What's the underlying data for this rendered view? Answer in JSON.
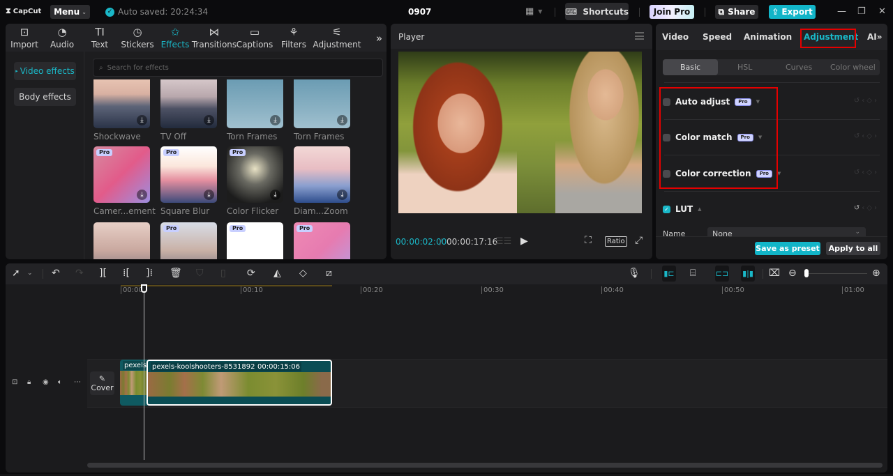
{
  "titlebar": {
    "app_name": "CapCut",
    "menu_label": "Menu",
    "autosave_text": "Auto saved: 20:24:34",
    "project_title": "0907",
    "shortcuts_label": "Shortcuts",
    "join_pro_label": "Join Pro",
    "share_label": "Share",
    "export_label": "Export"
  },
  "media_tabs": [
    {
      "label": "Import",
      "icon": "import-icon"
    },
    {
      "label": "Audio",
      "icon": "audio-icon"
    },
    {
      "label": "Text",
      "icon": "text-icon"
    },
    {
      "label": "Stickers",
      "icon": "stickers-icon"
    },
    {
      "label": "Effects",
      "icon": "effects-icon",
      "active": true
    },
    {
      "label": "Transitions",
      "icon": "transitions-icon"
    },
    {
      "label": "Captions",
      "icon": "captions-icon"
    },
    {
      "label": "Filters",
      "icon": "filters-icon"
    },
    {
      "label": "Adjustment",
      "icon": "adjustment-icon"
    }
  ],
  "effects_sidebar": {
    "items": [
      {
        "label": "Video effects",
        "active": true
      },
      {
        "label": "Body effects"
      }
    ]
  },
  "search": {
    "placeholder": "Search for effects"
  },
  "effects": [
    {
      "name": "Shockwave",
      "pro": false,
      "download": true
    },
    {
      "name": "TV Off",
      "pro": false,
      "download": true
    },
    {
      "name": "Torn Frames",
      "pro": false,
      "download": true
    },
    {
      "name": "Torn Frames",
      "pro": false,
      "download": true
    },
    {
      "name": "Camer...ement",
      "pro": true,
      "download": true
    },
    {
      "name": "Square Blur",
      "pro": true,
      "download": true
    },
    {
      "name": "Color Flicker",
      "pro": true,
      "download": true
    },
    {
      "name": "Diam...Zoom",
      "pro": false,
      "download": true
    },
    {
      "name": "",
      "pro": false
    },
    {
      "name": "",
      "pro": true
    },
    {
      "name": "",
      "pro": true
    },
    {
      "name": "",
      "pro": true
    }
  ],
  "pro_badge": "Pro",
  "player": {
    "title": "Player",
    "current_time": "00:00:02:00",
    "total_time": "00:00:17:16",
    "ratio_label": "Ratio"
  },
  "inspector": {
    "tabs": [
      "Video",
      "Speed",
      "Animation",
      "Adjustment",
      "AI"
    ],
    "active_tab": "Adjustment",
    "subtabs": [
      "Basic",
      "HSL",
      "Curves",
      "Color wheel"
    ],
    "active_subtab": "Basic",
    "options": [
      {
        "label": "Auto adjust",
        "checked": false,
        "pro": true
      },
      {
        "label": "Color match",
        "checked": false,
        "pro": true
      },
      {
        "label": "Color correction",
        "checked": false,
        "pro": true
      },
      {
        "label": "LUT",
        "checked": true,
        "pro": false
      }
    ],
    "lut_name_label": "Name",
    "lut_name_value": "None",
    "save_preset_label": "Save as preset",
    "apply_all_label": "Apply to all"
  },
  "timeline": {
    "ruler_ticks": [
      "00:00",
      "00:10",
      "00:20",
      "00:30",
      "00:40",
      "00:50",
      "01:00"
    ],
    "cover_label": "Cover",
    "clips": [
      {
        "label": "pexels"
      },
      {
        "label": "pexels-koolshooters-8531892",
        "duration": "00:00:15:06"
      }
    ]
  },
  "colors": {
    "accent": "#1ab8c8",
    "highlight_box": "#e50000",
    "clip": "#0a4d54"
  }
}
